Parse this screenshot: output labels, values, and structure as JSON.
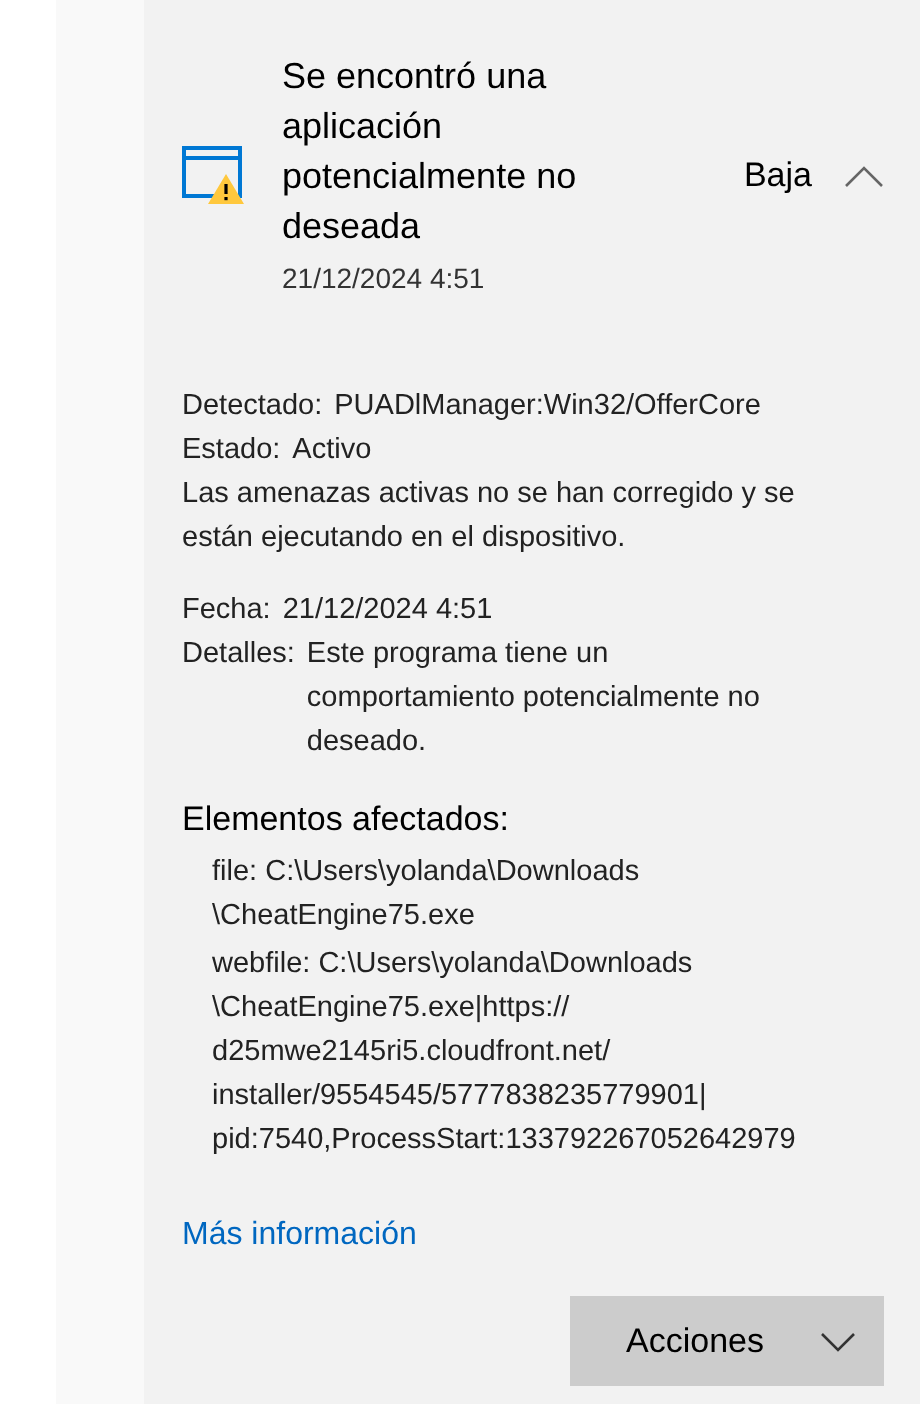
{
  "threat": {
    "title_lines": [
      "Se encontró una",
      "aplicación",
      "potencialmente no",
      "deseada"
    ],
    "date": "21/12/2024 4:51",
    "severity": "Baja",
    "expanded": true,
    "fields": [
      {
        "label": "Detectado:",
        "value_lines": [
          "PUADlManager:Win32/OfferCore"
        ]
      },
      {
        "label": "Estado:",
        "value_lines": [
          "Activo"
        ]
      }
    ],
    "description_lines": [
      "Las amenazas activas no se han corregido y se",
      "están ejecutando en el dispositivo."
    ],
    "fields2": [
      {
        "label": "Fecha:",
        "value_lines": [
          "21/12/2024 4:51"
        ]
      },
      {
        "label": "Detalles:",
        "value_lines": [
          "Este programa tiene un",
          "comportamiento potencialmente no",
          "deseado."
        ]
      }
    ],
    "affected_heading": "Elementos afectados:",
    "affected_items": [
      {
        "lines": [
          "file: C:\\Users\\yolanda\\Downloads",
          "\\CheatEngine75.exe"
        ]
      },
      {
        "lines": [
          "webfile: C:\\Users\\yolanda\\Downloads",
          "\\CheatEngine75.exe|https://",
          "d25mwe2145ri5.cloudfront.net/",
          "installer/9554545/5777838235779901|",
          "pid:7540,ProcessStart:133792267052642979"
        ]
      }
    ],
    "more_info_link": "Más información",
    "actions_button": "Acciones"
  }
}
